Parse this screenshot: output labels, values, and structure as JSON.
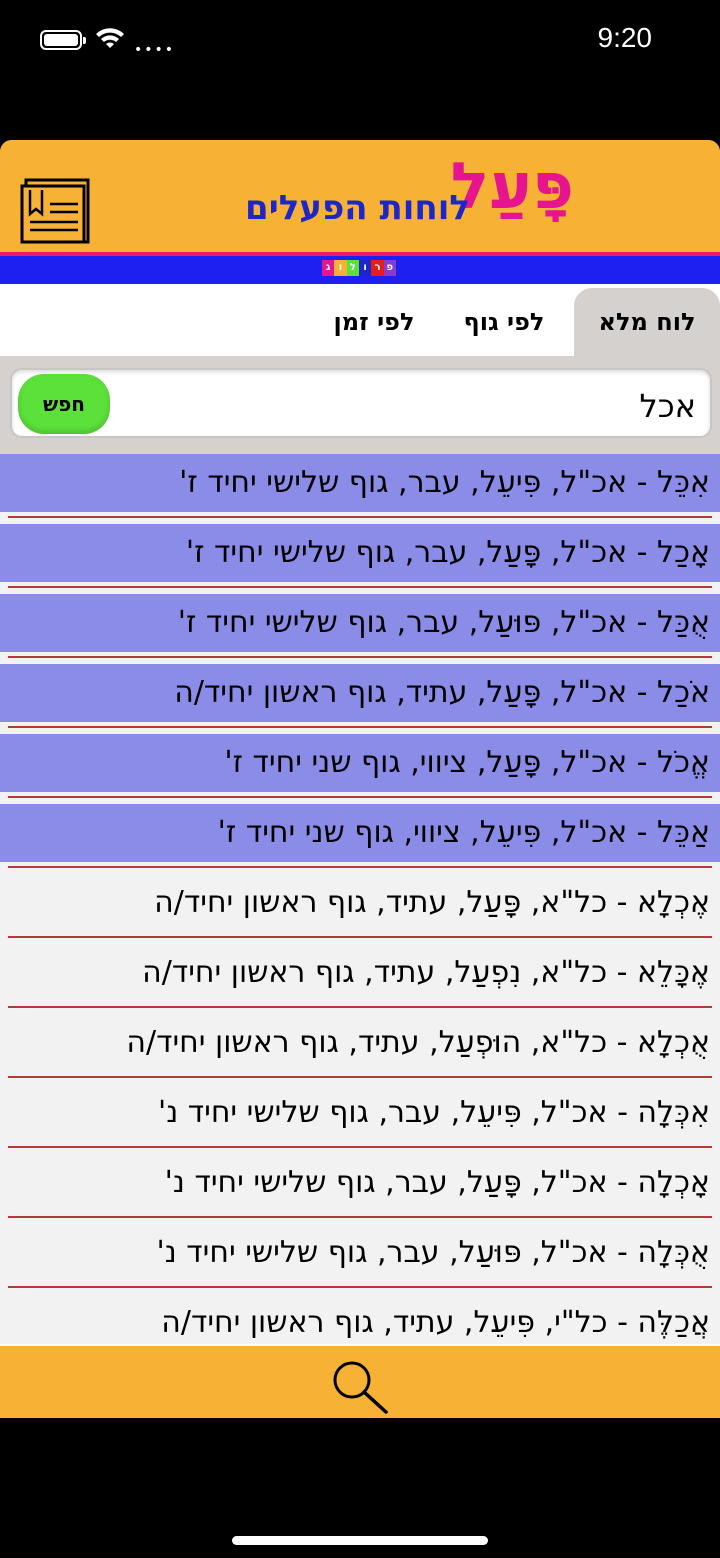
{
  "status_bar": {
    "time": "9:20"
  },
  "header": {
    "logo_main": "פָּעַל",
    "logo_sub": "לוחות הפעלים",
    "badge_letters": [
      "ג",
      "ו",
      "ל",
      "ו",
      "ר",
      "פ"
    ]
  },
  "tabs": [
    "לוח מלא",
    "לפי גוף",
    "לפי זמן"
  ],
  "search": {
    "value": "אכל",
    "button_label": "חפש"
  },
  "results": [
    {
      "text": "אִכֵּל - אכ\"ל, פִּיעֵל, עבר, גוף שלישי יחיד ז'",
      "highlighted": true
    },
    {
      "text": "אָכַל - אכ\"ל, פָּעַל, עבר, גוף שלישי יחיד ז'",
      "highlighted": true
    },
    {
      "text": "אֻכַּל - אכ\"ל, פּוּעַל, עבר, גוף שלישי יחיד ז'",
      "highlighted": true
    },
    {
      "text": "אֹכַל - אכ\"ל, פָּעַל, עתיד, גוף ראשון יחיד/ה",
      "highlighted": true
    },
    {
      "text": "אֱכֹל - אכ\"ל, פָּעַל, ציווי, גוף שני יחיד ז'",
      "highlighted": true
    },
    {
      "text": "אַכֵּל - אכ\"ל, פִּיעֵל, ציווי, גוף שני יחיד ז'",
      "highlighted": true
    },
    {
      "text": "אֶכְלָא - כל\"א, פָּעַל, עתיד, גוף ראשון יחיד/ה",
      "highlighted": false
    },
    {
      "text": "אֶכָּלֵא - כל\"א, נִפְעַל, עתיד, גוף ראשון יחיד/ה",
      "highlighted": false
    },
    {
      "text": "אֻכְלָא - כל\"א, הוּפְעַל, עתיד, גוף ראשון יחיד/ה",
      "highlighted": false
    },
    {
      "text": "אִכְּלָה - אכ\"ל, פִּיעֵל, עבר, גוף שלישי יחיד נ'",
      "highlighted": false
    },
    {
      "text": "אָכְלָה - אכ\"ל, פָּעַל, עבר, גוף שלישי יחיד נ'",
      "highlighted": false
    },
    {
      "text": "אֻכְּלָה - אכ\"ל, פּוּעַל, עבר, גוף שלישי יחיד נ'",
      "highlighted": false
    },
    {
      "text": "אֲכַלֶּה - כל\"י, פִּיעֵל, עתיד, גוף ראשון יחיד/ה",
      "highlighted": false
    }
  ],
  "colors": {
    "header_bg": "#f7b236",
    "logo_pink": "#e6158f",
    "logo_blue": "#1d27c8",
    "highlight_row": "#8b8be8",
    "search_button": "#5ce03a",
    "tab_active": "#d5d1cf"
  },
  "icons": {
    "menu": "book-icon",
    "bottom": "search-icon"
  }
}
